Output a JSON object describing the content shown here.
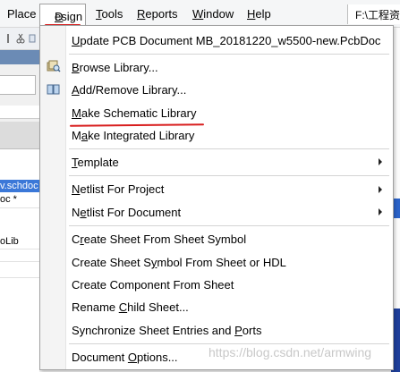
{
  "menubar": {
    "place": "Place",
    "design_d": "D",
    "design_rest": "esign",
    "tools_t": "T",
    "tools_rest": "ools",
    "reports_r": "R",
    "reports_rest": "eports",
    "window_w": "W",
    "window_rest": "indow",
    "help_h": "H",
    "help_rest": "elp",
    "path_text": "F:\\工程资"
  },
  "left_panel": {
    "sel_text": "v.schdoc",
    "text_doc": "oc *",
    "text_lib": "oLib"
  },
  "menu": {
    "items": [
      {
        "pre": "",
        "key": "U",
        "post": "pdate PCB Document MB_20181220_w5500-new.PcbDoc"
      },
      {
        "pre": "",
        "key": "B",
        "post": "rowse Library..."
      },
      {
        "pre": "",
        "key": "A",
        "post": "dd/Remove Library..."
      },
      {
        "pre": "",
        "key": "M",
        "post": "ake Schematic Library"
      },
      {
        "pre": "M",
        "key": "a",
        "post": "ke Integrated Library"
      },
      {
        "pre": "",
        "key": "T",
        "post": "emplate"
      },
      {
        "pre": "",
        "key": "N",
        "post": "etlist For Project"
      },
      {
        "pre": "N",
        "key": "e",
        "post": "tlist For Document"
      },
      {
        "pre": "C",
        "key": "r",
        "post": "eate Sheet From Sheet Symbol"
      },
      {
        "pre": "Create Sheet S",
        "key": "y",
        "post": "mbol From Sheet or HDL"
      },
      {
        "pre": "Create Component From Sheet",
        "key": "",
        "post": ""
      },
      {
        "pre": "Rename ",
        "key": "C",
        "post": "hild Sheet..."
      },
      {
        "pre": "Synchronize Sheet Entries and ",
        "key": "P",
        "post": "orts"
      },
      {
        "pre": "Document ",
        "key": "O",
        "post": "ptions..."
      }
    ]
  },
  "watermark": "https://blog.csdn.net/armwing",
  "colors": {
    "red_annotation": "#d81e1e",
    "selection_blue": "#3b78d8",
    "menu_border": "#a0a0a0"
  },
  "icons": [
    "browse-library-icon",
    "add-remove-library-icon",
    "submenu-arrow-icon"
  ]
}
